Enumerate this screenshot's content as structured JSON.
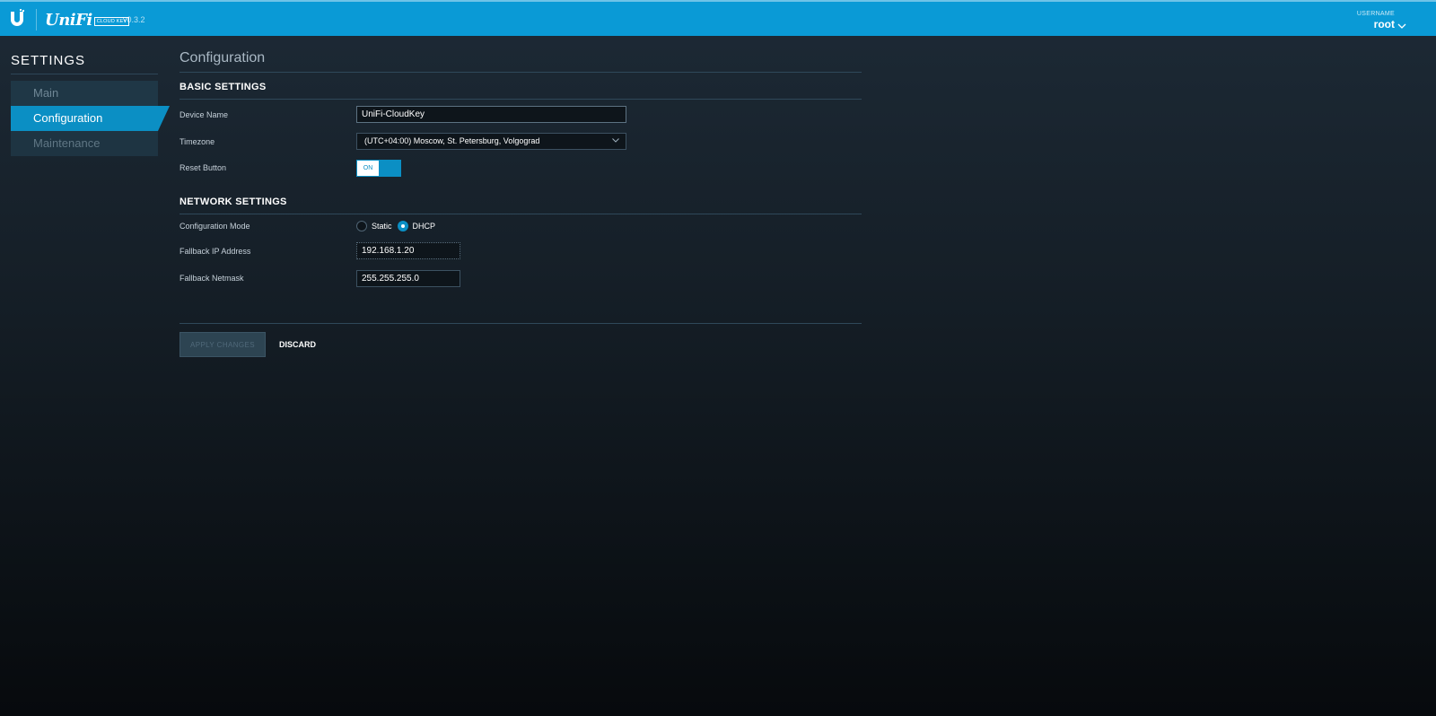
{
  "header": {
    "brand": "UniFi",
    "brand_sub": "CLOUD KEY",
    "version": "v0.3.2",
    "user_caption": "USERNAME",
    "username": "root",
    "icons": [
      "ubiquiti-logo-icon",
      "chevron-down-icon"
    ],
    "accent_color": "#0a9ad6"
  },
  "sidebar": {
    "title": "SETTINGS",
    "items": [
      {
        "label": "Main",
        "active": false
      },
      {
        "label": "Configuration",
        "active": true
      },
      {
        "label": "Maintenance",
        "active": false
      }
    ]
  },
  "main": {
    "title": "Configuration",
    "basic": {
      "title": "BASIC SETTINGS",
      "device_name_label": "Device Name",
      "device_name_value": "UniFi-CloudKey",
      "timezone_label": "Timezone",
      "timezone_value": "(UTC+04:00) Moscow, St. Petersburg, Volgograd",
      "reset_label": "Reset Button",
      "reset_state": "ON"
    },
    "network": {
      "title": "NETWORK SETTINGS",
      "mode_label": "Configuration Mode",
      "mode_options": [
        "Static",
        "DHCP"
      ],
      "mode_selected": "DHCP",
      "fallback_ip_label": "Fallback IP Address",
      "fallback_ip_value": "192.168.1.20",
      "fallback_mask_label": "Fallback Netmask",
      "fallback_mask_value": "255.255.255.0"
    },
    "actions": {
      "apply_label": "APPLY CHANGES",
      "discard_label": "DISCARD"
    }
  }
}
